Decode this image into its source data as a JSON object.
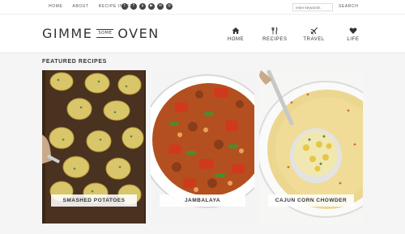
{
  "topbar": {
    "nav": [
      "HOME",
      "ABOUT",
      "RECIPE INDEX"
    ],
    "social_icons": [
      "twitter-icon",
      "facebook-icon",
      "pinterest-icon",
      "youtube-icon",
      "email-icon",
      "instagram-icon"
    ],
    "search_placeholder": "enter keywords",
    "search_button": "SEARCH"
  },
  "header": {
    "logo": {
      "left": "GIMME",
      "middle": "SOME",
      "right": "OVEN"
    },
    "nav": [
      {
        "label": "HOME",
        "icon": "house-icon"
      },
      {
        "label": "RECIPES",
        "icon": "fork-knife-icon"
      },
      {
        "label": "TRAVEL",
        "icon": "airplane-icon"
      },
      {
        "label": "LIFE",
        "icon": "heart-icon"
      }
    ]
  },
  "featured": {
    "title": "FEATURED RECIPES",
    "recipes": [
      {
        "label": "SMASHED POTATOES"
      },
      {
        "label": "JAMBALAYA"
      },
      {
        "label": "CAJUN CORN CHOWDER"
      }
    ]
  }
}
